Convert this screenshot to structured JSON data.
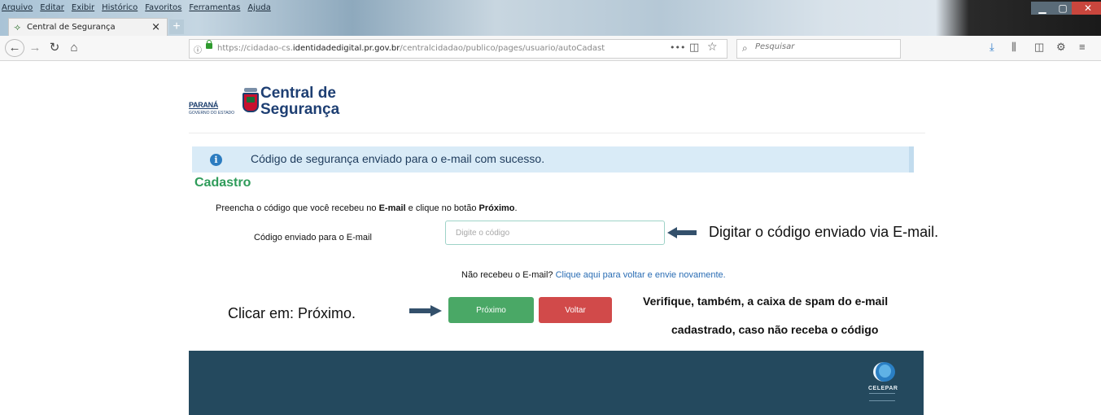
{
  "browser": {
    "menu": [
      "Arquivo",
      "Editar",
      "Exibir",
      "Histórico",
      "Favoritos",
      "Ferramentas",
      "Ajuda"
    ],
    "tab_title": "Central de Segurança",
    "url_prefix": "https://cidadao-cs.",
    "url_domain": "identidadedigital.pr.gov.br",
    "url_path": "/centralcidadao/publico/pages/usuario/autoCadast",
    "search_placeholder": "Pesquisar"
  },
  "header": {
    "brand": "Central de Segurança",
    "parana": "PARANÁ",
    "parana_sub": "GOVERNO DO ESTADO"
  },
  "alert": {
    "message": "Código de segurança enviado para o e-mail com sucesso."
  },
  "form": {
    "title": "Cadastro",
    "instruction_pre": "Preencha o código que  você recebeu no ",
    "instruction_email": "E-mail",
    "instruction_mid": " e clique no botão ",
    "instruction_btn": "Próximo",
    "instruction_end": ".",
    "code_label": "Código enviado para o E-mail",
    "code_placeholder": "Digite o código",
    "code_value": "",
    "resend_text": "Não recebeu o E-mail? ",
    "resend_link": "Clique aqui para voltar e envie novamente.",
    "next_label": "Próximo",
    "back_label": "Voltar"
  },
  "annotations": {
    "type_code": "Digitar o código enviado via E-mail.",
    "click_next": "Clicar em: Próximo.",
    "spam_line1": "Verifique, também, a caixa de spam do e-mail",
    "spam_line2": "cadastrado, caso não receba o código"
  },
  "footer": {
    "logo_text": "CELEPAR"
  },
  "colors": {
    "brand_blue": "#1e3f73",
    "success_green": "#4aa866",
    "danger_red": "#d14a4a",
    "info_bg": "#d9ebf7",
    "footer_bg": "#24495e",
    "heading_green": "#2f9c5a"
  }
}
